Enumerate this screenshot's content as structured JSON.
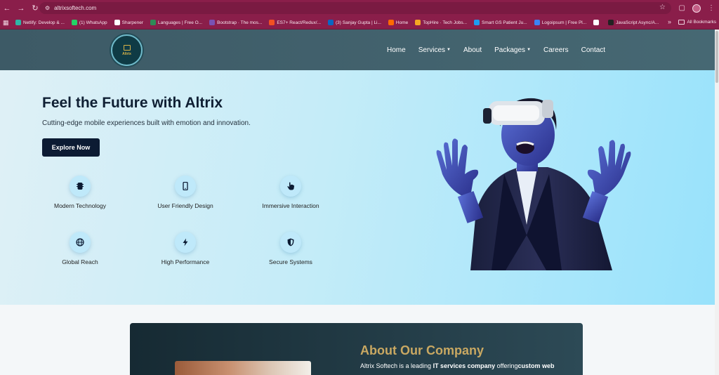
{
  "browser": {
    "url": "altrixsoftech.com",
    "bookmarks": [
      {
        "label": "Netlify: Develop & ...",
        "color": "#2fb5a6"
      },
      {
        "label": "(1) WhatsApp",
        "color": "#25d366"
      },
      {
        "label": "Sharpener",
        "color": "#ffffff"
      },
      {
        "label": "Languages | Free O...",
        "color": "#2e8b57"
      },
      {
        "label": "Bootstrap · The mos...",
        "color": "#7952b3"
      },
      {
        "label": "ES7+ React/Redux/...",
        "color": "#f25022"
      },
      {
        "label": "(3) Sanjay Gupta | Li...",
        "color": "#0a66c2"
      },
      {
        "label": "Home",
        "color": "#ff6a00"
      },
      {
        "label": "TopHire · Tech Jobs...",
        "color": "#f5a623"
      },
      {
        "label": "Smart GS Patient Ju...",
        "color": "#1d9bf0"
      },
      {
        "label": "Logoipsum | Free Pl...",
        "color": "#3b82f6"
      },
      {
        "label": "",
        "color": "#ffffff"
      },
      {
        "label": "JavaScript Async/A...",
        "color": "#222222"
      }
    ],
    "more": "»",
    "all_bookmarks": "All Bookmarks"
  },
  "header": {
    "logo_text": "Altrix",
    "nav": [
      {
        "label": "Home",
        "dropdown": false
      },
      {
        "label": "Services",
        "dropdown": true
      },
      {
        "label": "About",
        "dropdown": false
      },
      {
        "label": "Packages",
        "dropdown": true
      },
      {
        "label": "Careers",
        "dropdown": false
      },
      {
        "label": "Contact",
        "dropdown": false
      }
    ]
  },
  "hero": {
    "title": "Feel the Future with Altrix",
    "subtitle": "Cutting-edge mobile experiences built with emotion and innovation.",
    "cta": "Explore Now",
    "features": [
      {
        "label": "Modern Technology",
        "icon": "chip-icon"
      },
      {
        "label": "User Friendly Design",
        "icon": "mobile-icon"
      },
      {
        "label": "Immersive Interaction",
        "icon": "hand-pointer-icon"
      },
      {
        "label": "Global Reach",
        "icon": "globe-icon"
      },
      {
        "label": "High Performance",
        "icon": "bolt-icon"
      },
      {
        "label": "Secure Systems",
        "icon": "shield-icon"
      }
    ]
  },
  "about": {
    "title": "About Our Company",
    "text_part1": "Altrix Softech is a leading ",
    "text_bold1": "IT services company",
    "text_part2": " offering",
    "text_bold2": "custom web"
  },
  "colors": {
    "chrome": "#8a1e4a",
    "header": "#3d5a66",
    "cta": "#0c1b33",
    "about_title": "#c9a862"
  }
}
